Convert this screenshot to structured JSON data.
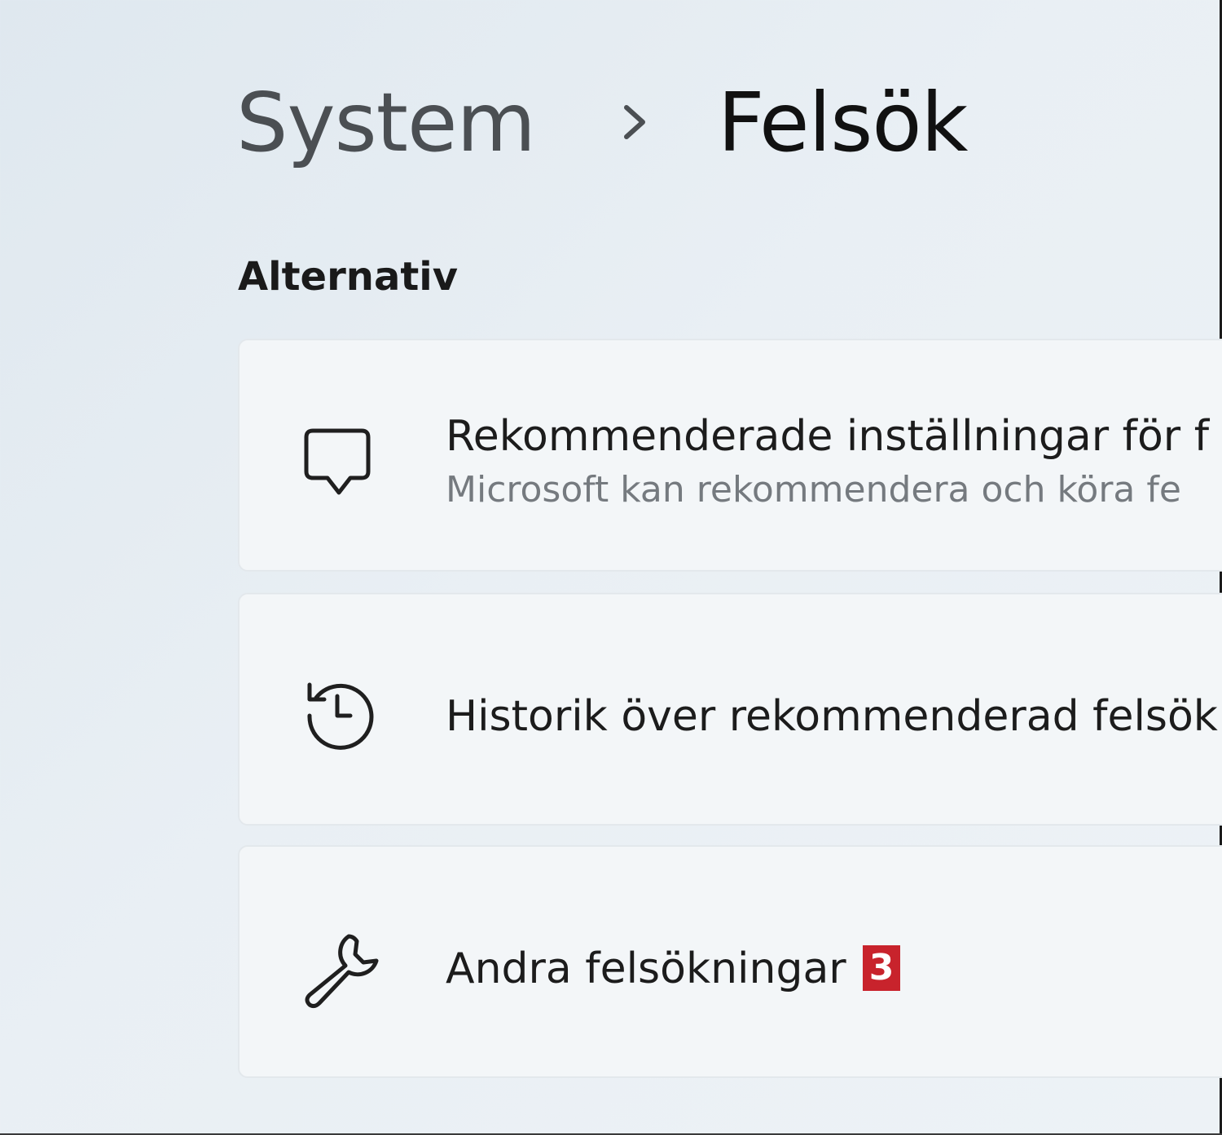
{
  "breadcrumb": {
    "parent": "System",
    "separator_icon": "chevron-right-icon",
    "current": "Felsök"
  },
  "section": {
    "heading": "Alternativ"
  },
  "cards": [
    {
      "icon": "chat-bubble-icon",
      "title": "Rekommenderade inställningar för f",
      "description": "Microsoft kan rekommendera och köra fe"
    },
    {
      "icon": "history-clock-icon",
      "title": "Historik över rekommenderad felsök"
    },
    {
      "icon": "wrench-icon",
      "title": "Andra felsökningar",
      "badge": "3"
    }
  ],
  "colors": {
    "badge": "#c8232c",
    "card_background": "#f3f6f8",
    "page_background": "#e9eff4"
  }
}
